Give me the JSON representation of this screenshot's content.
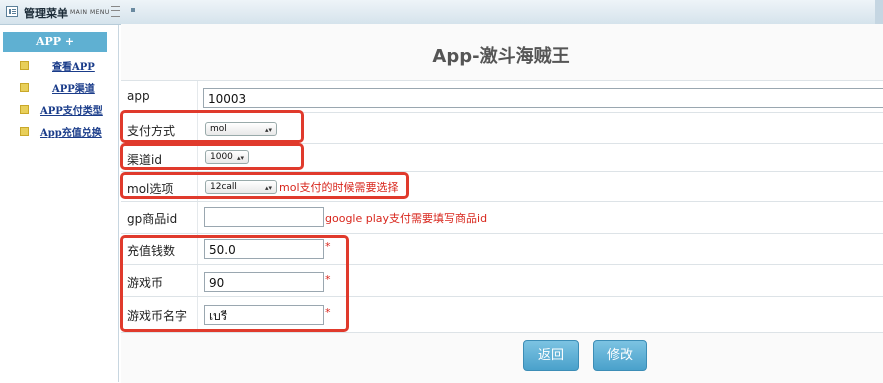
{
  "topbar": {
    "title": "管理菜单",
    "subtitle": "MAIN MENU"
  },
  "sidebar": {
    "header": "APP +",
    "items": [
      {
        "label": "查看APP"
      },
      {
        "label": "APP渠道"
      },
      {
        "label": "APP支付类型"
      },
      {
        "label": "App充值兑换"
      }
    ]
  },
  "page": {
    "title": "App-激斗海贼王"
  },
  "form": {
    "app": {
      "label": "app",
      "value": "10003"
    },
    "pay_method": {
      "label": "支付方式",
      "value": "mol"
    },
    "channel": {
      "label": "渠道id",
      "value": "1000"
    },
    "mol_option": {
      "label": "mol选项",
      "value": "12call",
      "hint": "mol支付的时候需要选择"
    },
    "gp_product": {
      "label": "gp商品id",
      "value": "",
      "hint": "google play支付需要填写商品id"
    },
    "amount": {
      "label": "充值钱数",
      "value": "50.0",
      "required": "*"
    },
    "coins": {
      "label": "游戏币",
      "value": "90",
      "required": "*"
    },
    "coin_name": {
      "label": "游戏币名字",
      "value": "เบรี",
      "required": "*"
    }
  },
  "actions": {
    "back": "返回",
    "modify": "修改"
  },
  "colors": {
    "accent": "#5fb0d2",
    "highlight": "#e03a2c",
    "button": "#4aa1cb"
  }
}
